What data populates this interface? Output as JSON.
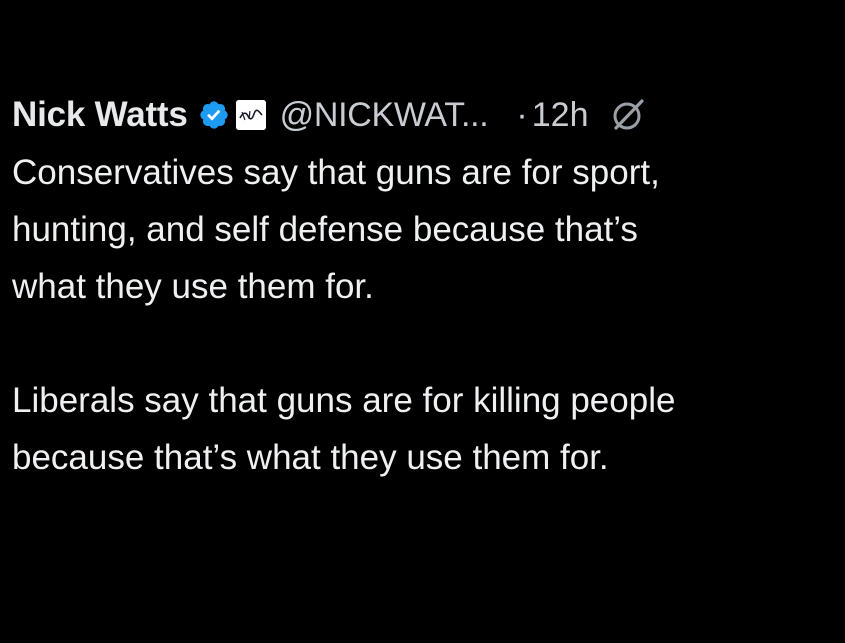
{
  "tweet": {
    "author_name": "Nick Watts",
    "handle": "@NICKWAT...",
    "separator": "·",
    "time": "12h",
    "verified_icon": "verified-badge-icon",
    "affiliate_icon": "affiliate-badge-icon",
    "grok_icon": "grok-icon",
    "text": {
      "line1": "Conservatives say that guns are for sport,",
      "line2": "hunting, and self defense because that’s",
      "line3": "what they use them for.",
      "line4": "Liberals say that guns are for killing people",
      "line5": "because that’s what they use them for."
    }
  },
  "colors": {
    "background": "#000000",
    "text": "#e7e9ea",
    "muted": "#c9cdd1",
    "verified": "#1d9bf0"
  }
}
